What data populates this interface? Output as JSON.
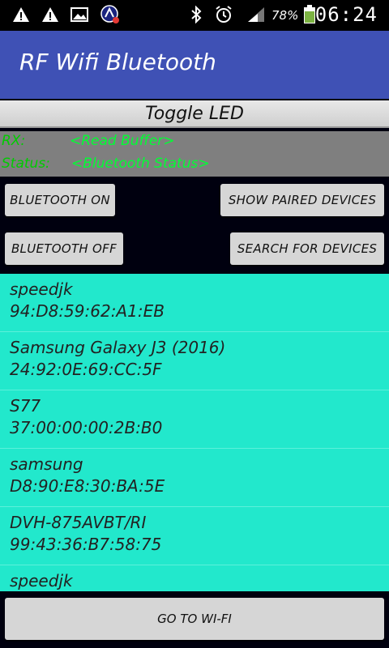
{
  "status_bar": {
    "battery_percent": "78%",
    "time": "06:24",
    "icons": [
      "warning-icon",
      "warning-icon",
      "image-icon",
      "app-notification-icon",
      "bluetooth-icon",
      "alarm-icon",
      "signal-icon",
      "battery-icon"
    ]
  },
  "app_bar": {
    "title": "RF Wifi Bluetooth"
  },
  "toggle_led": {
    "label": "Toggle LED"
  },
  "info": {
    "rx_label": "RX:",
    "rx_value": "<Read Buffer>",
    "status_label": "Status:",
    "status_value": "<Bluetooth Status>"
  },
  "buttons": {
    "bt_on": "BLUETOOTH ON",
    "show_paired": "SHOW PAIRED DEVICES",
    "bt_off": "BLUETOOTH OFF",
    "search": "SEARCH FOR DEVICES",
    "goto_wifi": "GO TO WI-FI"
  },
  "devices": [
    {
      "name": "speedjk",
      "address": "94:D8:59:62:A1:EB"
    },
    {
      "name": "Samsung Galaxy J3 (2016)",
      "address": "24:92:0E:69:CC:5F"
    },
    {
      "name": "S77",
      "address": "37:00:00:00:2B:B0"
    },
    {
      "name": "samsung",
      "address": "D8:90:E8:30:BA:5E"
    },
    {
      "name": "DVH-875AVBT/RI",
      "address": "99:43:36:B7:58:75"
    },
    {
      "name": "speedjk",
      "address": ""
    }
  ],
  "colors": {
    "app_bar": "#3f51b5",
    "list_bg": "#22e8cc",
    "status_green": "#00ff33"
  }
}
